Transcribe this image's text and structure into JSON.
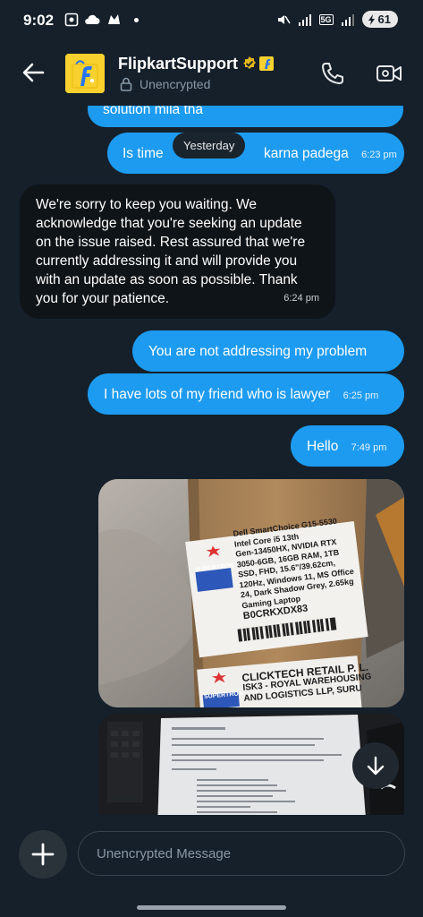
{
  "status_bar": {
    "time": "9:02",
    "network_badge": "5G",
    "battery_level": "61"
  },
  "header": {
    "contact_name": "FlipkartSupport",
    "encryption_status": "Unencrypted",
    "icons": [
      "back-arrow-icon",
      "flipkart-logo",
      "verified-badge-icon",
      "business-badge-icon",
      "lock-icon",
      "phone-icon",
      "video-camera-icon"
    ]
  },
  "messages": [
    {
      "direction": "out",
      "text": "solution mila tha",
      "time": ""
    },
    {
      "direction": "out",
      "text": "Is time",
      "text_right": "karna padega",
      "time": "6:23 pm"
    },
    {
      "direction": "in",
      "text": "We're sorry to keep you waiting. We acknowledge that you're seeking an update on the issue raised. Rest assured that we're currently addressing it and will provide you with an update as soon as possible. Thank you for your patience.",
      "time": "6:24 pm"
    },
    {
      "direction": "out",
      "text": "You are not addressing my  problem",
      "time": ""
    },
    {
      "direction": "out",
      "text": "I have lots of my friend who is lawyer",
      "time": "6:25 pm"
    },
    {
      "direction": "out",
      "text": "Hello",
      "time": "7:49 pm"
    }
  ],
  "date_divider": "Yesterday",
  "photo_1": {
    "label_lines": [
      "Dell SmartChoice G15-5530",
      "Intel Core i5 13th",
      "Gen-13450HX, NVIDIA RTX",
      "3050-6GB, 16GB RAM, 1TB",
      "SSD, FHD, 15.6\"/39.62cm,",
      "120Hz, Windows 11, MS Office",
      "24, Dark Shadow Grey, 2.65kg",
      "Gaming Laptop"
    ],
    "code": "B0CRKXDX83",
    "brand": "SUPERTRON",
    "seller_line_1": "CLICKTECH RETAIL P. L.",
    "seller_line_2": "ISK3 - ROYAL WAREHOUSING",
    "seller_line_3": "AND LOGISTICS LLP, SURU"
  },
  "composer": {
    "placeholder": "Unencrypted Message"
  },
  "colors": {
    "background": "#15202b",
    "outgoing_bubble": "#1d9bf0",
    "incoming_bubble": "#0f1418",
    "muted_text": "#8899a6"
  }
}
